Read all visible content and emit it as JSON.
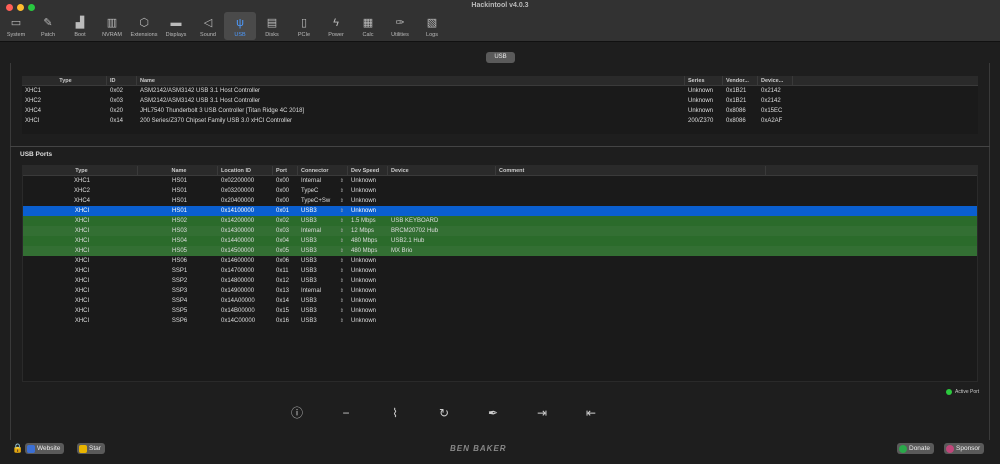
{
  "window": {
    "title": "Hackintool v4.0.3"
  },
  "toolbar": [
    {
      "label": "System",
      "icon": "laptop-icon",
      "glyph": "▭"
    },
    {
      "label": "Patch",
      "icon": "pencil-icon",
      "glyph": "✎"
    },
    {
      "label": "Boot",
      "icon": "boot-icon",
      "glyph": "▟"
    },
    {
      "label": "NVRAM",
      "icon": "memory-icon",
      "glyph": "▥"
    },
    {
      "label": "Extensions",
      "icon": "cube-icon",
      "glyph": "⬡"
    },
    {
      "label": "Displays",
      "icon": "monitor-icon",
      "glyph": "▬"
    },
    {
      "label": "Sound",
      "icon": "speaker-icon",
      "glyph": "◁"
    },
    {
      "label": "USB",
      "icon": "usb-icon",
      "glyph": "ψ",
      "active": true
    },
    {
      "label": "Disks",
      "icon": "disk-icon",
      "glyph": "▤"
    },
    {
      "label": "PCIe",
      "icon": "pcie-card-icon",
      "glyph": "▯"
    },
    {
      "label": "Power",
      "icon": "power-icon",
      "glyph": "ϟ"
    },
    {
      "label": "Calc",
      "icon": "calculator-icon",
      "glyph": "▦"
    },
    {
      "label": "Utilities",
      "icon": "wrench-icon",
      "glyph": "✑"
    },
    {
      "label": "Logs",
      "icon": "log-icon",
      "glyph": "▧"
    }
  ],
  "tab": {
    "label": "USB"
  },
  "controllers": {
    "headers": [
      "Type",
      "ID",
      "Name",
      "Series",
      "Vendor...",
      "Device..."
    ],
    "rows": [
      [
        "XHC1",
        "0x02",
        "ASM2142/ASM3142 USB 3.1 Host Controller",
        "Unknown",
        "0x1B21",
        "0x2142"
      ],
      [
        "XHC2",
        "0x03",
        "ASM2142/ASM3142 USB 3.1 Host Controller",
        "Unknown",
        "0x1B21",
        "0x2142"
      ],
      [
        "XHC4",
        "0x20",
        "JHL7540 Thunderbolt 3 USB Controller [Titan Ridge 4C 2018]",
        "Unknown",
        "0x8086",
        "0x15EC"
      ],
      [
        "XHCI",
        "0x14",
        "200 Series/Z370 Chipset Family USB 3.0 xHCI Controller",
        "200/Z370",
        "0x8086",
        "0xA2AF"
      ]
    ]
  },
  "ports_section": {
    "title": "USB Ports"
  },
  "ports": {
    "headers": [
      "Type",
      "Name",
      "Location ID",
      "Port",
      "Connector",
      "Dev Speed",
      "Device",
      "Comment"
    ],
    "rows": [
      {
        "type": "XHC1",
        "name": "HS01",
        "loc": "0x02200000",
        "port": "0x00",
        "conn": "Internal",
        "speed": "Unknown",
        "device": "",
        "comment": "",
        "state": ""
      },
      {
        "type": "XHC2",
        "name": "HS01",
        "loc": "0x03200000",
        "port": "0x00",
        "conn": "TypeC",
        "speed": "Unknown",
        "device": "",
        "comment": "",
        "state": ""
      },
      {
        "type": "XHC4",
        "name": "HS01",
        "loc": "0x20400000",
        "port": "0x00",
        "conn": "TypeC+Sw",
        "speed": "Unknown",
        "device": "",
        "comment": "",
        "state": ""
      },
      {
        "type": "XHCI",
        "name": "HS01",
        "loc": "0x14100000",
        "port": "0x01",
        "conn": "USB3",
        "speed": "Unknown",
        "device": "",
        "comment": "",
        "state": "sel"
      },
      {
        "type": "XHCI",
        "name": "HS02",
        "loc": "0x14200000",
        "port": "0x02",
        "conn": "USB3",
        "speed": "1.5 Mbps",
        "device": "USB KEYBOARD",
        "comment": "",
        "state": "grn"
      },
      {
        "type": "XHCI",
        "name": "HS03",
        "loc": "0x14300000",
        "port": "0x03",
        "conn": "Internal",
        "speed": "12 Mbps",
        "device": "BRCM20702 Hub",
        "comment": "",
        "state": "grn2"
      },
      {
        "type": "XHCI",
        "name": "HS04",
        "loc": "0x14400000",
        "port": "0x04",
        "conn": "USB3",
        "speed": "480 Mbps",
        "device": "USB2.1 Hub",
        "comment": "",
        "state": "grn"
      },
      {
        "type": "XHCI",
        "name": "HS05",
        "loc": "0x14500000",
        "port": "0x05",
        "conn": "USB3",
        "speed": "480 Mbps",
        "device": "MX Brio",
        "comment": "",
        "state": "grn2"
      },
      {
        "type": "XHCI",
        "name": "HS06",
        "loc": "0x14600000",
        "port": "0x06",
        "conn": "USB3",
        "speed": "Unknown",
        "device": "",
        "comment": "",
        "state": ""
      },
      {
        "type": "XHCI",
        "name": "SSP1",
        "loc": "0x14700000",
        "port": "0x11",
        "conn": "USB3",
        "speed": "Unknown",
        "device": "",
        "comment": "",
        "state": ""
      },
      {
        "type": "XHCI",
        "name": "SSP2",
        "loc": "0x14800000",
        "port": "0x12",
        "conn": "USB3",
        "speed": "Unknown",
        "device": "",
        "comment": "",
        "state": ""
      },
      {
        "type": "XHCI",
        "name": "SSP3",
        "loc": "0x14900000",
        "port": "0x13",
        "conn": "Internal",
        "speed": "Unknown",
        "device": "",
        "comment": "",
        "state": ""
      },
      {
        "type": "XHCI",
        "name": "SSP4",
        "loc": "0x14A00000",
        "port": "0x14",
        "conn": "USB3",
        "speed": "Unknown",
        "device": "",
        "comment": "",
        "state": ""
      },
      {
        "type": "XHCI",
        "name": "SSP5",
        "loc": "0x14B00000",
        "port": "0x15",
        "conn": "USB3",
        "speed": "Unknown",
        "device": "",
        "comment": "",
        "state": ""
      },
      {
        "type": "XHCI",
        "name": "SSP6",
        "loc": "0x14C00000",
        "port": "0x16",
        "conn": "USB3",
        "speed": "Unknown",
        "device": "",
        "comment": "",
        "state": ""
      }
    ]
  },
  "legend": {
    "label": "Active Port",
    "color": "#2bc93d"
  },
  "actions": [
    {
      "name": "info-icon",
      "glyph": "ⓘ"
    },
    {
      "name": "minus-icon",
      "glyph": "−"
    },
    {
      "name": "broom-icon",
      "glyph": "⌇"
    },
    {
      "name": "refresh-icon",
      "glyph": "↻"
    },
    {
      "name": "injector-icon",
      "glyph": "✒"
    },
    {
      "name": "import-icon",
      "glyph": "⇥"
    },
    {
      "name": "export-icon",
      "glyph": "⇤"
    }
  ],
  "footer": {
    "website": "Website",
    "star": "Star",
    "brand": "BEN BAKER",
    "donate": "Donate",
    "sponsor": "Sponsor"
  },
  "colors": {
    "selected": "#0a5fd0",
    "active_row": "#2b6b2b",
    "accent": "#4d9bff"
  }
}
